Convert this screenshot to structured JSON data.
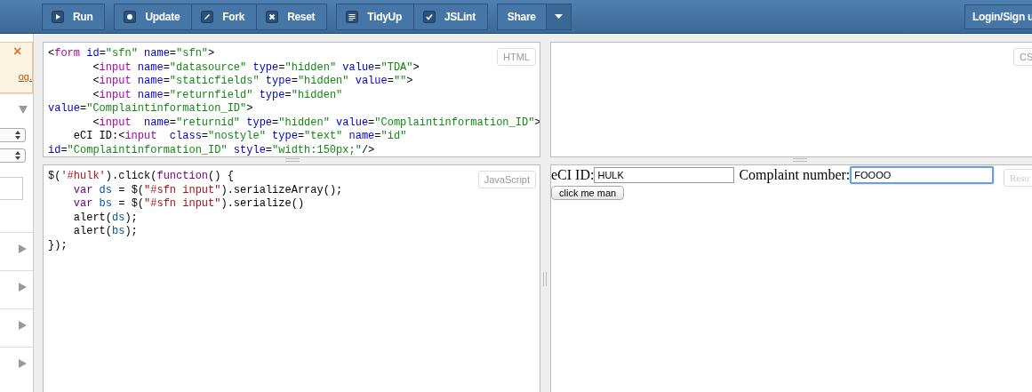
{
  "toolbar": {
    "groups": [
      {
        "buttons": [
          {
            "label": "Run"
          }
        ]
      },
      {
        "buttons": [
          {
            "label": "Update"
          },
          {
            "label": "Fork"
          },
          {
            "label": "Reset"
          }
        ]
      },
      {
        "buttons": [
          {
            "label": "TidyUp"
          },
          {
            "label": "JSLint"
          }
        ]
      },
      {
        "buttons": [
          {
            "label": "Share"
          }
        ],
        "dropdown": true
      }
    ],
    "login": "Login/Sign u"
  },
  "sidebar": {
    "notice": {
      "close": "×",
      "link": "og."
    },
    "sections": [
      {
        "expanded": true,
        "controls": [
          {
            "kind": "select"
          },
          {
            "kind": "select"
          },
          {
            "kind": "field"
          }
        ]
      },
      {
        "expanded": false
      },
      {
        "expanded": false
      },
      {
        "expanded": false
      },
      {
        "expanded": false
      }
    ]
  },
  "html_panel": {
    "label": "HTML",
    "lines": [
      [
        {
          "kind": "text",
          "text": "<"
        },
        {
          "kind": "tag",
          "text": "form"
        },
        {
          "kind": "attribute",
          "text": " id"
        },
        {
          "kind": "text",
          "text": "="
        },
        {
          "kind": "value",
          "text": "\"sfn\""
        },
        {
          "kind": "attribute",
          "text": " name"
        },
        {
          "kind": "text",
          "text": "="
        },
        {
          "kind": "value",
          "text": "\"sfn\""
        },
        {
          "kind": "text",
          "text": ">"
        }
      ],
      [
        {
          "kind": "text",
          "text": "       <"
        },
        {
          "kind": "tag",
          "text": "input"
        },
        {
          "kind": "attribute",
          "text": " name"
        },
        {
          "kind": "text",
          "text": "="
        },
        {
          "kind": "value",
          "text": "\"datasource\""
        },
        {
          "kind": "attribute",
          "text": " type"
        },
        {
          "kind": "text",
          "text": "="
        },
        {
          "kind": "value",
          "text": "\"hidden\""
        },
        {
          "kind": "attribute",
          "text": " value"
        },
        {
          "kind": "text",
          "text": "="
        },
        {
          "kind": "value",
          "text": "\"TDA\""
        },
        {
          "kind": "text",
          "text": ">"
        }
      ],
      [
        {
          "kind": "text",
          "text": "       <"
        },
        {
          "kind": "tag",
          "text": "input"
        },
        {
          "kind": "attribute",
          "text": " name"
        },
        {
          "kind": "text",
          "text": "="
        },
        {
          "kind": "value",
          "text": "\"staticfields\""
        },
        {
          "kind": "attribute",
          "text": " type"
        },
        {
          "kind": "text",
          "text": "="
        },
        {
          "kind": "value",
          "text": "\"hidden\""
        },
        {
          "kind": "attribute",
          "text": " value"
        },
        {
          "kind": "text",
          "text": "="
        },
        {
          "kind": "value",
          "text": "\"\""
        },
        {
          "kind": "text",
          "text": ">"
        }
      ],
      [
        {
          "kind": "text",
          "text": "       <"
        },
        {
          "kind": "tag",
          "text": "input"
        },
        {
          "kind": "attribute",
          "text": " name"
        },
        {
          "kind": "text",
          "text": "="
        },
        {
          "kind": "value",
          "text": "\"returnfield\""
        },
        {
          "kind": "attribute",
          "text": " type"
        },
        {
          "kind": "text",
          "text": "="
        },
        {
          "kind": "value",
          "text": "\"hidden\""
        }
      ],
      [
        {
          "kind": "attribute",
          "text": "value"
        },
        {
          "kind": "text",
          "text": "="
        },
        {
          "kind": "value",
          "text": "\"Complaintinformation_ID\""
        },
        {
          "kind": "text",
          "text": ">"
        }
      ],
      [
        {
          "kind": "text",
          "text": "       <"
        },
        {
          "kind": "tag",
          "text": "input"
        },
        {
          "kind": "attribute",
          "text": "  name"
        },
        {
          "kind": "text",
          "text": "="
        },
        {
          "kind": "value",
          "text": "\"returnid\""
        },
        {
          "kind": "attribute",
          "text": " type"
        },
        {
          "kind": "text",
          "text": "="
        },
        {
          "kind": "value",
          "text": "\"hidden\""
        },
        {
          "kind": "attribute",
          "text": " value"
        },
        {
          "kind": "text",
          "text": "="
        },
        {
          "kind": "value",
          "text": "\"Complaintinformation_ID\""
        },
        {
          "kind": "text",
          "text": ">"
        }
      ],
      [
        {
          "kind": "text",
          "text": "    eCI ID:<"
        },
        {
          "kind": "tag",
          "text": "input"
        },
        {
          "kind": "attribute",
          "text": "  class"
        },
        {
          "kind": "text",
          "text": "="
        },
        {
          "kind": "value",
          "text": "\"nostyle\""
        },
        {
          "kind": "attribute",
          "text": " type"
        },
        {
          "kind": "text",
          "text": "="
        },
        {
          "kind": "value",
          "text": "\"text\""
        },
        {
          "kind": "attribute",
          "text": " name"
        },
        {
          "kind": "text",
          "text": "="
        },
        {
          "kind": "value",
          "text": "\"id\""
        }
      ],
      [
        {
          "kind": "attribute",
          "text": "id"
        },
        {
          "kind": "text",
          "text": "="
        },
        {
          "kind": "value",
          "text": "\"Complaintinformation_ID\""
        },
        {
          "kind": "attribute",
          "text": " style"
        },
        {
          "kind": "text",
          "text": "="
        },
        {
          "kind": "value",
          "text": "\"width:150px;\""
        },
        {
          "kind": "text",
          "text": "/>"
        }
      ]
    ]
  },
  "css_panel": {
    "label": "CS"
  },
  "js_panel": {
    "label": "JavaScript",
    "lines": [
      [
        {
          "kind": "text",
          "text": "$("
        },
        {
          "kind": "string",
          "text": "'#hulk'"
        },
        {
          "kind": "text",
          "text": ").click("
        },
        {
          "kind": "keyword",
          "text": "function"
        },
        {
          "kind": "text",
          "text": "() {"
        }
      ],
      [
        {
          "kind": "keyword",
          "text": "    var"
        },
        {
          "kind": "variable",
          "text": " ds"
        },
        {
          "kind": "text",
          "text": " = $("
        },
        {
          "kind": "string",
          "text": "\"#sfn input\""
        },
        {
          "kind": "text",
          "text": ").serializeArray();"
        }
      ],
      [
        {
          "kind": "keyword",
          "text": "    var"
        },
        {
          "kind": "variable",
          "text": " bs"
        },
        {
          "kind": "text",
          "text": " = $("
        },
        {
          "kind": "string",
          "text": "\"#sfn input\""
        },
        {
          "kind": "text",
          "text": ").serialize()"
        }
      ],
      [
        {
          "kind": "text",
          "text": "    alert("
        },
        {
          "kind": "variable",
          "text": "ds"
        },
        {
          "kind": "text",
          "text": ");"
        }
      ],
      [
        {
          "kind": "text",
          "text": "    alert("
        },
        {
          "kind": "variable",
          "text": "bs"
        },
        {
          "kind": "text",
          "text": ");"
        }
      ],
      [
        {
          "kind": "text",
          "text": "});"
        }
      ]
    ]
  },
  "result_panel": {
    "label": "Resu",
    "fields": [
      {
        "label": "eCI ID:",
        "value": "HULK",
        "focused": false
      },
      {
        "label": "Complaint number:",
        "value": "FOOOO",
        "focused": true
      }
    ],
    "button": "click me man"
  }
}
